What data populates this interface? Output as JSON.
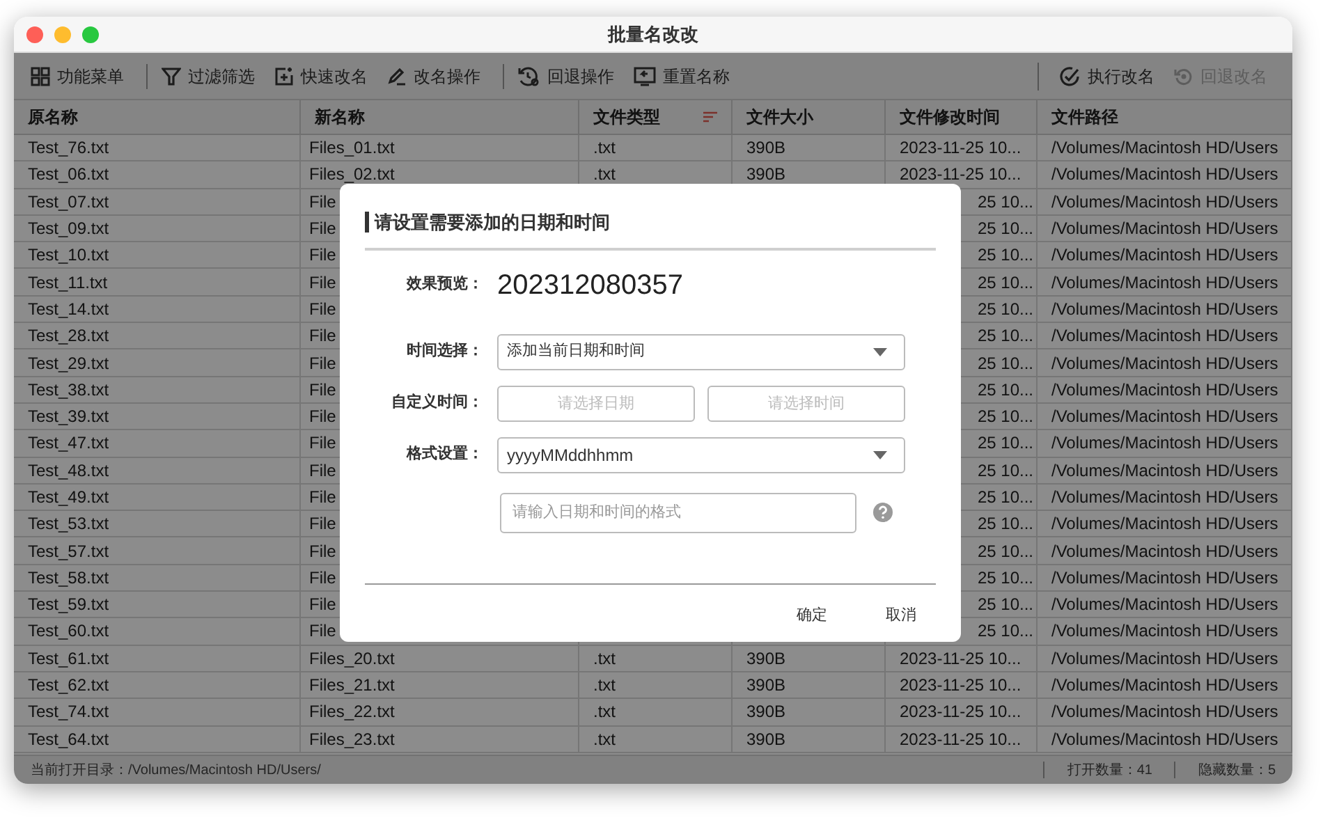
{
  "window": {
    "title": "批量名改改"
  },
  "toolbar": [
    {
      "label": "功能菜单",
      "disabled": false
    },
    {
      "label": "过滤筛选",
      "disabled": false
    },
    {
      "label": "快速改名",
      "disabled": false
    },
    {
      "label": "改名操作",
      "disabled": false
    },
    {
      "label": "回退操作",
      "disabled": false
    },
    {
      "label": "重置名称",
      "disabled": false
    },
    {
      "label": "执行改名",
      "disabled": false
    },
    {
      "label": "回退改名",
      "disabled": true
    }
  ],
  "table": {
    "columns": [
      {
        "label": "原名称",
        "sorted": false
      },
      {
        "label": "新名称",
        "sorted": false
      },
      {
        "label": "文件类型",
        "sorted": true
      },
      {
        "label": "文件大小",
        "sorted": false
      },
      {
        "label": "文件修改时间",
        "sorted": false
      },
      {
        "label": "文件路径",
        "sorted": false
      }
    ],
    "rows": [
      {
        "original": "Test_76.txt",
        "new_name": "Files_01.txt",
        "type": ".txt",
        "size": "390B",
        "modified": "2023-11-25 10...",
        "path": "/Volumes/Macintosh HD/Users",
        "covered": false
      },
      {
        "original": "Test_06.txt",
        "new_name": "Files_02.txt",
        "type": ".txt",
        "size": "390B",
        "modified": "2023-11-25 10...",
        "path": "/Volumes/Macintosh HD/Users",
        "covered": false
      },
      {
        "original": "Test_07.txt",
        "new_name": "File",
        "modified": "25 10...",
        "path": "/Volumes/Macintosh HD/Users",
        "covered": true
      },
      {
        "original": "Test_09.txt",
        "new_name": "File",
        "modified": "25 10...",
        "path": "/Volumes/Macintosh HD/Users",
        "covered": true
      },
      {
        "original": "Test_10.txt",
        "new_name": "File",
        "modified": "25 10...",
        "path": "/Volumes/Macintosh HD/Users",
        "covered": true
      },
      {
        "original": "Test_11.txt",
        "new_name": "File",
        "modified": "25 10...",
        "path": "/Volumes/Macintosh HD/Users",
        "covered": true
      },
      {
        "original": "Test_14.txt",
        "new_name": "File",
        "modified": "25 10...",
        "path": "/Volumes/Macintosh HD/Users",
        "covered": true
      },
      {
        "original": "Test_28.txt",
        "new_name": "File",
        "modified": "25 10...",
        "path": "/Volumes/Macintosh HD/Users",
        "covered": true
      },
      {
        "original": "Test_29.txt",
        "new_name": "File",
        "modified": "25 10...",
        "path": "/Volumes/Macintosh HD/Users",
        "covered": true
      },
      {
        "original": "Test_38.txt",
        "new_name": "File",
        "modified": "25 10...",
        "path": "/Volumes/Macintosh HD/Users",
        "covered": true
      },
      {
        "original": "Test_39.txt",
        "new_name": "File",
        "modified": "25 10...",
        "path": "/Volumes/Macintosh HD/Users",
        "covered": true
      },
      {
        "original": "Test_47.txt",
        "new_name": "File",
        "modified": "25 10...",
        "path": "/Volumes/Macintosh HD/Users",
        "covered": true
      },
      {
        "original": "Test_48.txt",
        "new_name": "File",
        "modified": "25 10...",
        "path": "/Volumes/Macintosh HD/Users",
        "covered": true
      },
      {
        "original": "Test_49.txt",
        "new_name": "File",
        "modified": "25 10...",
        "path": "/Volumes/Macintosh HD/Users",
        "covered": true
      },
      {
        "original": "Test_53.txt",
        "new_name": "File",
        "modified": "25 10...",
        "path": "/Volumes/Macintosh HD/Users",
        "covered": true
      },
      {
        "original": "Test_57.txt",
        "new_name": "File",
        "modified": "25 10...",
        "path": "/Volumes/Macintosh HD/Users",
        "covered": true
      },
      {
        "original": "Test_58.txt",
        "new_name": "File",
        "modified": "25 10...",
        "path": "/Volumes/Macintosh HD/Users",
        "covered": true
      },
      {
        "original": "Test_59.txt",
        "new_name": "File",
        "modified": "25 10...",
        "path": "/Volumes/Macintosh HD/Users",
        "covered": true
      },
      {
        "original": "Test_60.txt",
        "new_name": "File",
        "modified": "25 10...",
        "path": "/Volumes/Macintosh HD/Users",
        "covered": true
      },
      {
        "original": "Test_61.txt",
        "new_name": "Files_20.txt",
        "type": ".txt",
        "size": "390B",
        "modified": "2023-11-25 10...",
        "path": "/Volumes/Macintosh HD/Users",
        "covered": false
      },
      {
        "original": "Test_62.txt",
        "new_name": "Files_21.txt",
        "type": ".txt",
        "size": "390B",
        "modified": "2023-11-25 10...",
        "path": "/Volumes/Macintosh HD/Users",
        "covered": false
      },
      {
        "original": "Test_74.txt",
        "new_name": "Files_22.txt",
        "type": ".txt",
        "size": "390B",
        "modified": "2023-11-25 10...",
        "path": "/Volumes/Macintosh HD/Users",
        "covered": false
      },
      {
        "original": "Test_64.txt",
        "new_name": "Files_23.txt",
        "type": ".txt",
        "size": "390B",
        "modified": "2023-11-25 10...",
        "path": "/Volumes/Macintosh HD/Users",
        "covered": false
      }
    ]
  },
  "status_bar": {
    "directory": "当前打开目录：/Volumes/Macintosh HD/Users/",
    "open_count": "打开数量：41",
    "hidden_count": "隐藏数量：5"
  },
  "dialog": {
    "title": "请设置需要添加的日期和时间",
    "preview": {
      "label": "效果预览：",
      "value": "202312080357"
    },
    "time_select": {
      "label": "时间选择：",
      "value": "添加当前日期和时间"
    },
    "custom_time": {
      "label": "自定义时间：",
      "date_placeholder": "请选择日期",
      "time_placeholder": "请选择时间"
    },
    "format": {
      "label": "格式设置：",
      "value": "yyyyMMddhhmm"
    },
    "format_input": {
      "placeholder": "请输入日期和时间的格式"
    },
    "buttons": [
      "确定",
      "取消"
    ]
  }
}
